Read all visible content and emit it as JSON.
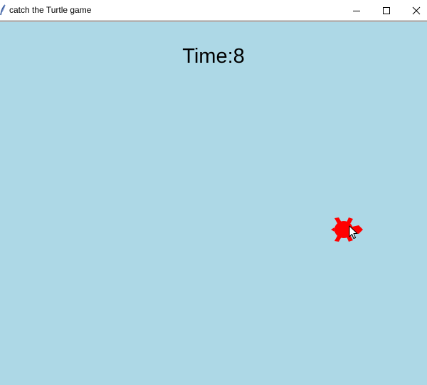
{
  "window": {
    "title": "catch the Turtle game",
    "controls": {
      "minimize": "minimize",
      "maximize": "maximize",
      "close": "close"
    }
  },
  "game": {
    "timer_text": "Time:8",
    "background_color": "#add8e6",
    "turtle_color": "#ff0000"
  },
  "icons": {
    "app": "feather-icon",
    "turtle": "turtle-icon",
    "cursor": "mouse-pointer-icon"
  }
}
